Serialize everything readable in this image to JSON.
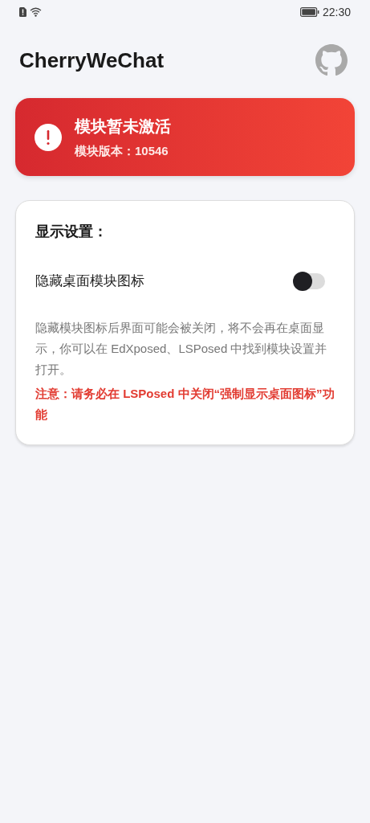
{
  "status_bar": {
    "time": "22:30"
  },
  "app_bar": {
    "title": "CherryWeChat"
  },
  "status_card": {
    "active": false,
    "title": "模块暂未激活",
    "version": "模块版本：10546"
  },
  "settings_card": {
    "title": "显示设置：",
    "items": [
      {
        "kind": "switch",
        "label": "隐藏桌面模块图标",
        "on": false
      }
    ],
    "description": "隐藏模块图标后界面可能会被关闭，将不会再在桌面显示，你可以在 EdXposed、LSPosed 中找到模块设置并打开。",
    "warning": "注意：请务必在 LSPosed 中关闭“强制显示桌面图标”功能"
  }
}
